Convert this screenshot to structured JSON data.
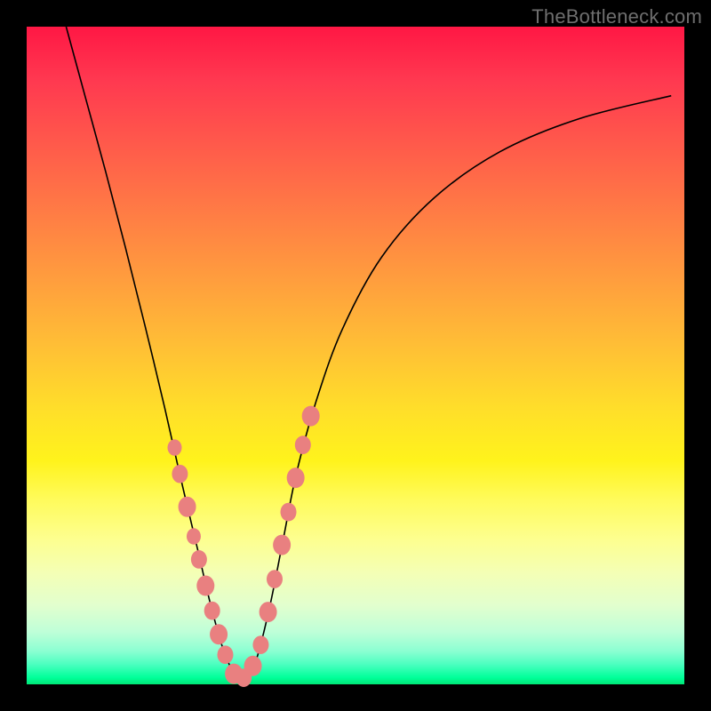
{
  "watermark": "TheBottleneck.com",
  "chart_data": {
    "type": "line",
    "title": "",
    "xlabel": "",
    "ylabel": "",
    "xlim": [
      0,
      1
    ],
    "ylim": [
      0,
      1
    ],
    "grid": false,
    "legend": false,
    "annotations": [],
    "curve_description": "V-shaped bottleneck curve descending steeply to a minimum near x≈0.32 then rising asymptotically",
    "series": [
      {
        "name": "bottleneck-curve",
        "color": "#000000",
        "x": [
          0.06,
          0.09,
          0.12,
          0.15,
          0.18,
          0.21,
          0.235,
          0.26,
          0.28,
          0.3,
          0.32,
          0.335,
          0.35,
          0.37,
          0.39,
          0.41,
          0.44,
          0.48,
          0.54,
          0.62,
          0.72,
          0.84,
          0.98
        ],
        "y": [
          1.0,
          0.89,
          0.78,
          0.665,
          0.545,
          0.42,
          0.31,
          0.205,
          0.12,
          0.05,
          0.01,
          0.01,
          0.04,
          0.12,
          0.22,
          0.32,
          0.43,
          0.54,
          0.65,
          0.74,
          0.81,
          0.86,
          0.895
        ]
      }
    ],
    "markers": {
      "name": "highlight-beads",
      "color": "#e98080",
      "note": "Cluster of bead markers along both arms of the V near the bottom",
      "points": [
        {
          "x": 0.225,
          "y": 0.36,
          "r": 8
        },
        {
          "x": 0.233,
          "y": 0.32,
          "r": 9
        },
        {
          "x": 0.244,
          "y": 0.27,
          "r": 10
        },
        {
          "x": 0.254,
          "y": 0.225,
          "r": 8
        },
        {
          "x": 0.262,
          "y": 0.19,
          "r": 9
        },
        {
          "x": 0.272,
          "y": 0.15,
          "r": 10
        },
        {
          "x": 0.282,
          "y": 0.112,
          "r": 9
        },
        {
          "x": 0.292,
          "y": 0.076,
          "r": 10
        },
        {
          "x": 0.302,
          "y": 0.045,
          "r": 9
        },
        {
          "x": 0.315,
          "y": 0.016,
          "r": 10
        },
        {
          "x": 0.33,
          "y": 0.01,
          "r": 9
        },
        {
          "x": 0.344,
          "y": 0.028,
          "r": 10
        },
        {
          "x": 0.356,
          "y": 0.06,
          "r": 9
        },
        {
          "x": 0.367,
          "y": 0.11,
          "r": 10
        },
        {
          "x": 0.377,
          "y": 0.16,
          "r": 9
        },
        {
          "x": 0.388,
          "y": 0.212,
          "r": 10
        },
        {
          "x": 0.398,
          "y": 0.262,
          "r": 9
        },
        {
          "x": 0.409,
          "y": 0.314,
          "r": 10
        },
        {
          "x": 0.42,
          "y": 0.364,
          "r": 9
        },
        {
          "x": 0.432,
          "y": 0.408,
          "r": 10
        }
      ]
    }
  }
}
